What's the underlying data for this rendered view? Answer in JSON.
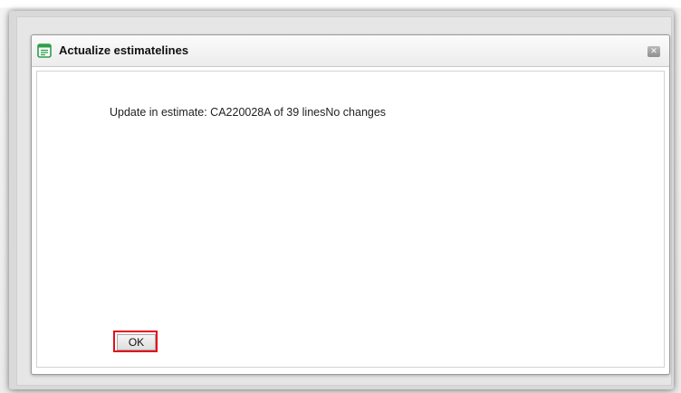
{
  "dialog": {
    "title": "Actualize estimatelines",
    "close_icon_glyph": "✕",
    "message": "Update in estimate: CA220028A of 39 linesNo changes",
    "ok_label": "OK"
  },
  "icons": {
    "title_icon": "document-list-icon",
    "close_icon": "close-icon"
  },
  "colors": {
    "highlight_border": "#e3101a",
    "title_icon_green": "#2e9e4a"
  }
}
